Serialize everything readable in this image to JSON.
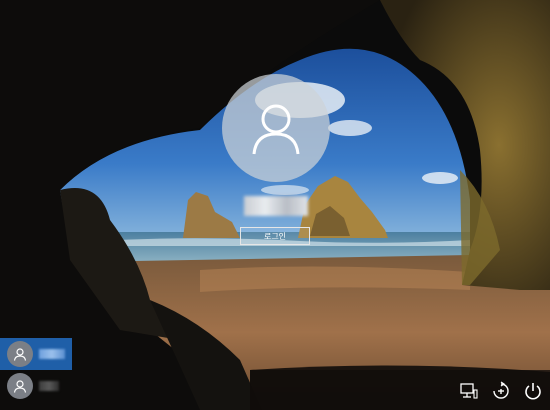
{
  "login": {
    "sign_in_label": "로그인"
  },
  "users": [
    {
      "selected": true
    },
    {
      "selected": false
    }
  ],
  "icons": {
    "avatar": "user-avatar-icon",
    "network": "network-icon",
    "ease_of_access": "ease-of-access-icon",
    "power": "power-icon"
  },
  "colors": {
    "selected_user": "#1f5fa8",
    "avatar_circle": "#cdd2d7"
  }
}
